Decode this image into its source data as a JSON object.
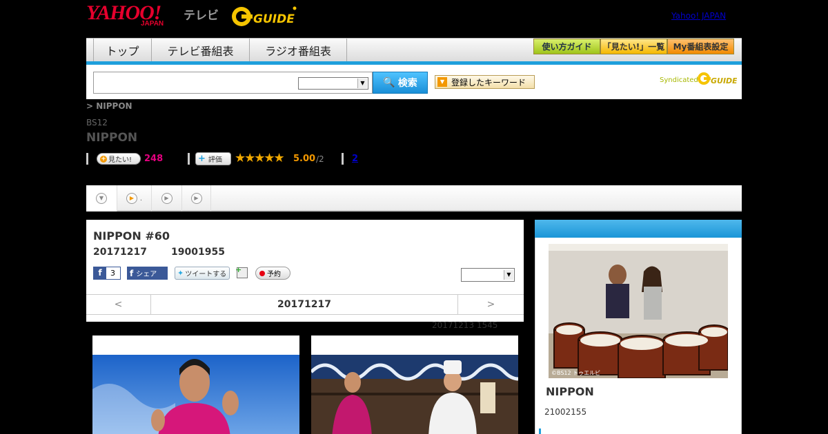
{
  "header": {
    "yahoo_logo": "YAHOO!",
    "yahoo_logo_sub": "JAPAN",
    "tv_label": "テレビ",
    "gguide_logo": "G-GUIDE",
    "yahoo_japan_link": "Yahoo! JAPAN"
  },
  "nav": {
    "tabs": [
      "トップ",
      "テレビ番組表",
      "ラジオ番組表"
    ],
    "ribbons": [
      "使い方ガイド",
      "「見たい!」一覧",
      "My番組表設定"
    ]
  },
  "search": {
    "button_label": "検索",
    "keyword_button": "登録したキーワード",
    "syndicated_label": "Syndicated"
  },
  "program": {
    "breadcrumb": "> NIPPON",
    "channel": "BS12",
    "title": "NIPPON",
    "mitai_label": "見たい!",
    "mitai_count": "248",
    "hyoka_label": "評価",
    "stars": "★★★★★",
    "score": "5.00",
    "score_count": "/2",
    "review_link": "2"
  },
  "episode": {
    "title": "NIPPON #60",
    "date": "20171217",
    "time": "19001955",
    "fb_count": "3",
    "fb_share": "シェア",
    "tweet": "ツイートする",
    "reserve": "予約",
    "prev": "<",
    "pager_date": "20171217",
    "next": ">",
    "updated": "20171213  1545"
  },
  "sidebar": {
    "copyright": "©BS12 トゥエルビ",
    "title": "NIPPON",
    "time": "21002155"
  },
  "colors": {
    "accent_blue": "#1e9fdc",
    "yahoo_red": "#e6002d",
    "mitai_pink": "#e4007f",
    "score_orange": "#f39800"
  }
}
